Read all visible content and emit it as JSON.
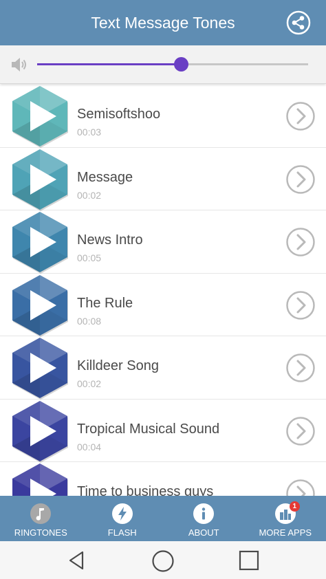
{
  "app": {
    "title": "Text Message Tones"
  },
  "volume": {
    "level": 0.53,
    "accent_color": "#6a3fc4"
  },
  "tones": [
    {
      "title": "Semisoftshoo",
      "duration": "00:03",
      "color": "#5fb7b9"
    },
    {
      "title": "Message",
      "duration": "00:02",
      "color": "#4fa3b6"
    },
    {
      "title": "News Intro",
      "duration": "00:05",
      "color": "#3f86ad"
    },
    {
      "title": "The Rule",
      "duration": "00:08",
      "color": "#3a6ea6"
    },
    {
      "title": "Killdeer Song",
      "duration": "00:02",
      "color": "#3855a0"
    },
    {
      "title": "Tropical Musical Sound",
      "duration": "00:04",
      "color": "#3b45a0"
    },
    {
      "title": "Time to business guys",
      "duration": "",
      "color": "#3a3a9d"
    }
  ],
  "tabs": [
    {
      "label": "RINGTONES",
      "icon": "music-note-icon"
    },
    {
      "label": "FLASH",
      "icon": "lightning-icon"
    },
    {
      "label": "ABOUT",
      "icon": "info-icon"
    },
    {
      "label": "MORE APPS",
      "icon": "apps-icon",
      "badge": "1"
    }
  ],
  "theme": {
    "bar_color": "#5f8db3"
  }
}
